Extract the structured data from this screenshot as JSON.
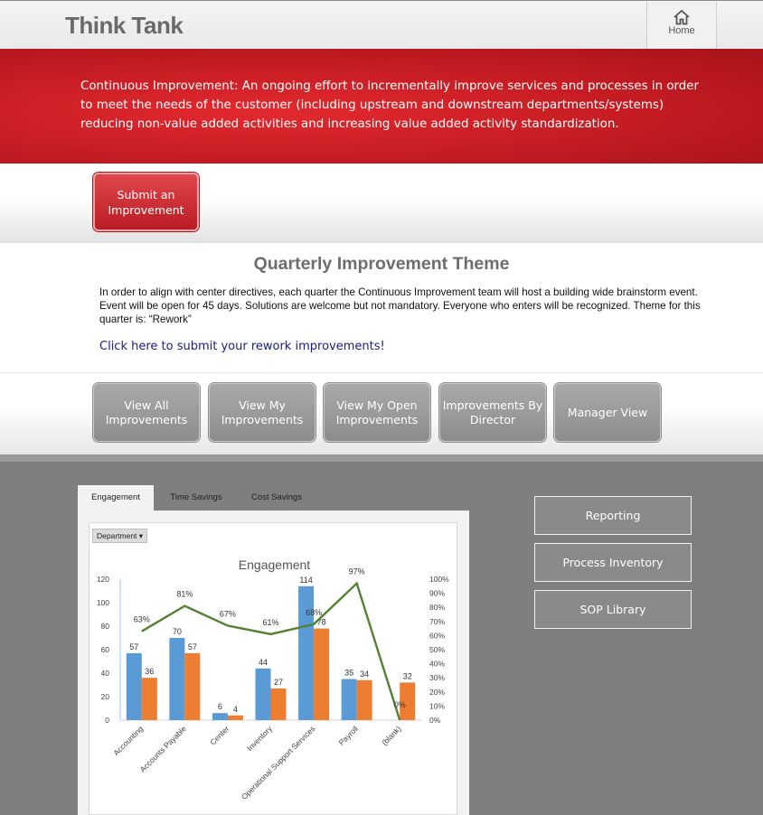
{
  "header": {
    "brand": "Think Tank",
    "home_label": "Home",
    "home_icon": "home-icon"
  },
  "banner": {
    "text": "Continuous Improvement: An ongoing effort to incrementally improve services and processes in order to meet the needs of the customer (including upstream and downstream departments/systems) reducing non-value added activities and increasing value added activity standardization."
  },
  "submit": {
    "label": "Submit an Improvement"
  },
  "quarterly": {
    "title": "Quarterly Improvement Theme",
    "text": "In order to align with center directives, each quarter the Continuous Improvement team will host a building wide brainstorm event. Event will be open for 45 days. Solutions are welcome but not mandatory. Everyone who enters will be recognized. Theme for this quarter is: “Rework”",
    "link": "Click here to submit your rework improvements!"
  },
  "nav": [
    "View All Improvements",
    "View My Improvements",
    "View My Open Improvements",
    "Improvements By Director",
    "Manager View"
  ],
  "tabs": [
    "Engagement",
    "Time Savings",
    "Cost Savings"
  ],
  "active_tab": "Engagement",
  "filter": {
    "label": "Department",
    "icon": "dropdown-arrow-icon"
  },
  "side_buttons": [
    "Reporting",
    "Process Inventory",
    "SOP Library"
  ],
  "colors": {
    "accent_red": "#c91e24",
    "series_blue": "#5b9bd5",
    "series_orange": "#ed7d31",
    "line_green": "#548235"
  },
  "chart_data": {
    "type": "bar",
    "title": "Engagement",
    "categories": [
      "Accounting",
      "Accounts Payable",
      "Center",
      "Inventory",
      "Operational Support Services",
      "Payroll",
      "(blank)"
    ],
    "series": [
      {
        "type": "bar",
        "values": [
          57,
          70,
          6,
          44,
          114,
          35,
          null
        ]
      },
      {
        "type": "bar",
        "values": [
          36,
          57,
          4,
          27,
          78,
          34,
          32
        ]
      },
      {
        "type": "line",
        "axis": "right",
        "values": [
          63,
          81,
          67,
          61,
          68,
          97,
          0
        ],
        "labels": [
          "63%",
          "81%",
          "67%",
          "61%",
          "68%",
          "97%",
          "0%"
        ]
      }
    ],
    "ylim": [
      0,
      120
    ],
    "yticks": [
      "0",
      "20",
      "40",
      "60",
      "80",
      "100",
      "120"
    ],
    "y2lim": [
      0,
      100
    ],
    "y2ticks": [
      "0%",
      "10%",
      "20%",
      "30%",
      "40%",
      "50%",
      "60%",
      "70%",
      "80%",
      "90%",
      "100%"
    ],
    "grid": false
  }
}
